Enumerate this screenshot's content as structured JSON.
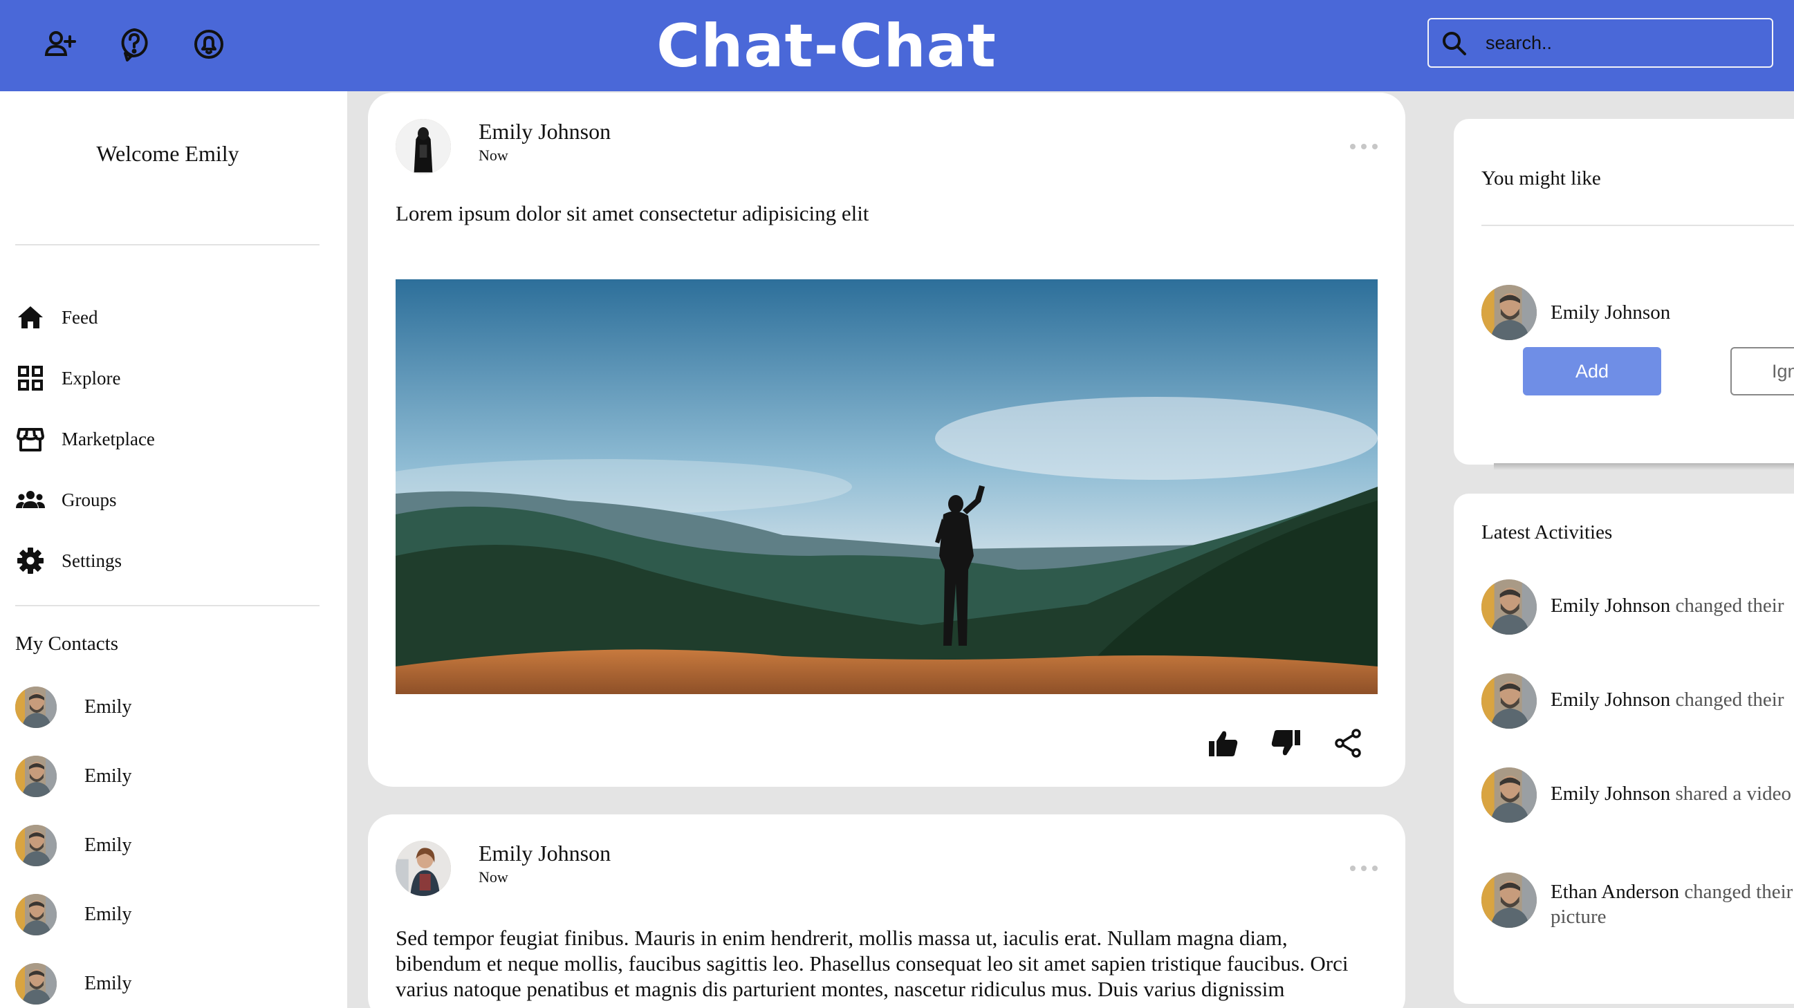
{
  "app": {
    "title": "Chat-Chat"
  },
  "header": {
    "icons": [
      "add-user-icon",
      "help-icon",
      "notification-icon"
    ],
    "search": {
      "placeholder": "search..",
      "value": ""
    },
    "color": "#4a68d8"
  },
  "sidebar": {
    "welcome": "Welcome Emily",
    "nav": [
      {
        "label": "Feed",
        "icon": "home-icon"
      },
      {
        "label": "Explore",
        "icon": "grid-icon"
      },
      {
        "label": "Marketplace",
        "icon": "store-icon"
      },
      {
        "label": "Groups",
        "icon": "groups-icon"
      },
      {
        "label": "Settings",
        "icon": "gear-icon"
      }
    ],
    "contacts_title": "My Contacts",
    "contacts": [
      {
        "name": "Emily"
      },
      {
        "name": "Emily"
      },
      {
        "name": "Emily"
      },
      {
        "name": "Emily"
      },
      {
        "name": "Emily"
      }
    ]
  },
  "feed": {
    "posts": [
      {
        "author": "Emily Johnson",
        "time": "Now",
        "text": "Lorem ipsum dolor sit amet consectetur adipisicing elit",
        "image": "mountain-landscape-photo"
      },
      {
        "author": "Emily Johnson",
        "time": "Now",
        "text": "Sed tempor feugiat finibus. Mauris in enim hendrerit, mollis massa ut, iaculis erat. Nullam magna diam, bibendum et neque mollis, faucibus sagittis leo. Phasellus consequat leo sit amet sapien tristique faucibus. Orci varius natoque penatibus et magnis dis parturient montes, nascetur ridiculus mus. Duis varius dignissim"
      }
    ]
  },
  "right": {
    "suggest": {
      "title": "You might like",
      "name": "Emily Johnson",
      "add_label": "Add",
      "ignore_label": "Ignore"
    },
    "activities": {
      "title": "Latest Activities",
      "items": [
        {
          "name": "Emily Johnson",
          "action": "changed their"
        },
        {
          "name": "Emily Johnson",
          "action": "changed their"
        },
        {
          "name": "Emily Johnson",
          "action": "shared a video"
        },
        {
          "name": "Ethan Anderson",
          "action": "changed their picture"
        }
      ]
    }
  }
}
